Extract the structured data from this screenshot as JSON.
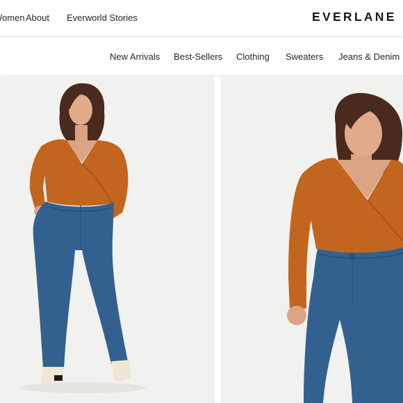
{
  "header": {
    "nav_links": [
      {
        "label": "Women"
      },
      {
        "label": "About"
      },
      {
        "label": "Everworld Stories"
      }
    ],
    "logo": "EVERLANE"
  },
  "categories": [
    {
      "label": "New Arrivals"
    },
    {
      "label": "Best-Sellers"
    },
    {
      "label": "Clothing"
    },
    {
      "label": "Sweaters"
    },
    {
      "label": "Jeans & Denim"
    }
  ],
  "products": [
    {
      "image": "model-full-body-rust-wrap-top-blue-jeans"
    },
    {
      "image": "model-closeup-rust-wrap-top-blue-jeans"
    }
  ],
  "colors": {
    "sweater": "#c2651f",
    "denim": "#33618f",
    "hair": "#4a2a1e",
    "skin": "#dfa988",
    "photo_bg": "#f1f1ef"
  }
}
